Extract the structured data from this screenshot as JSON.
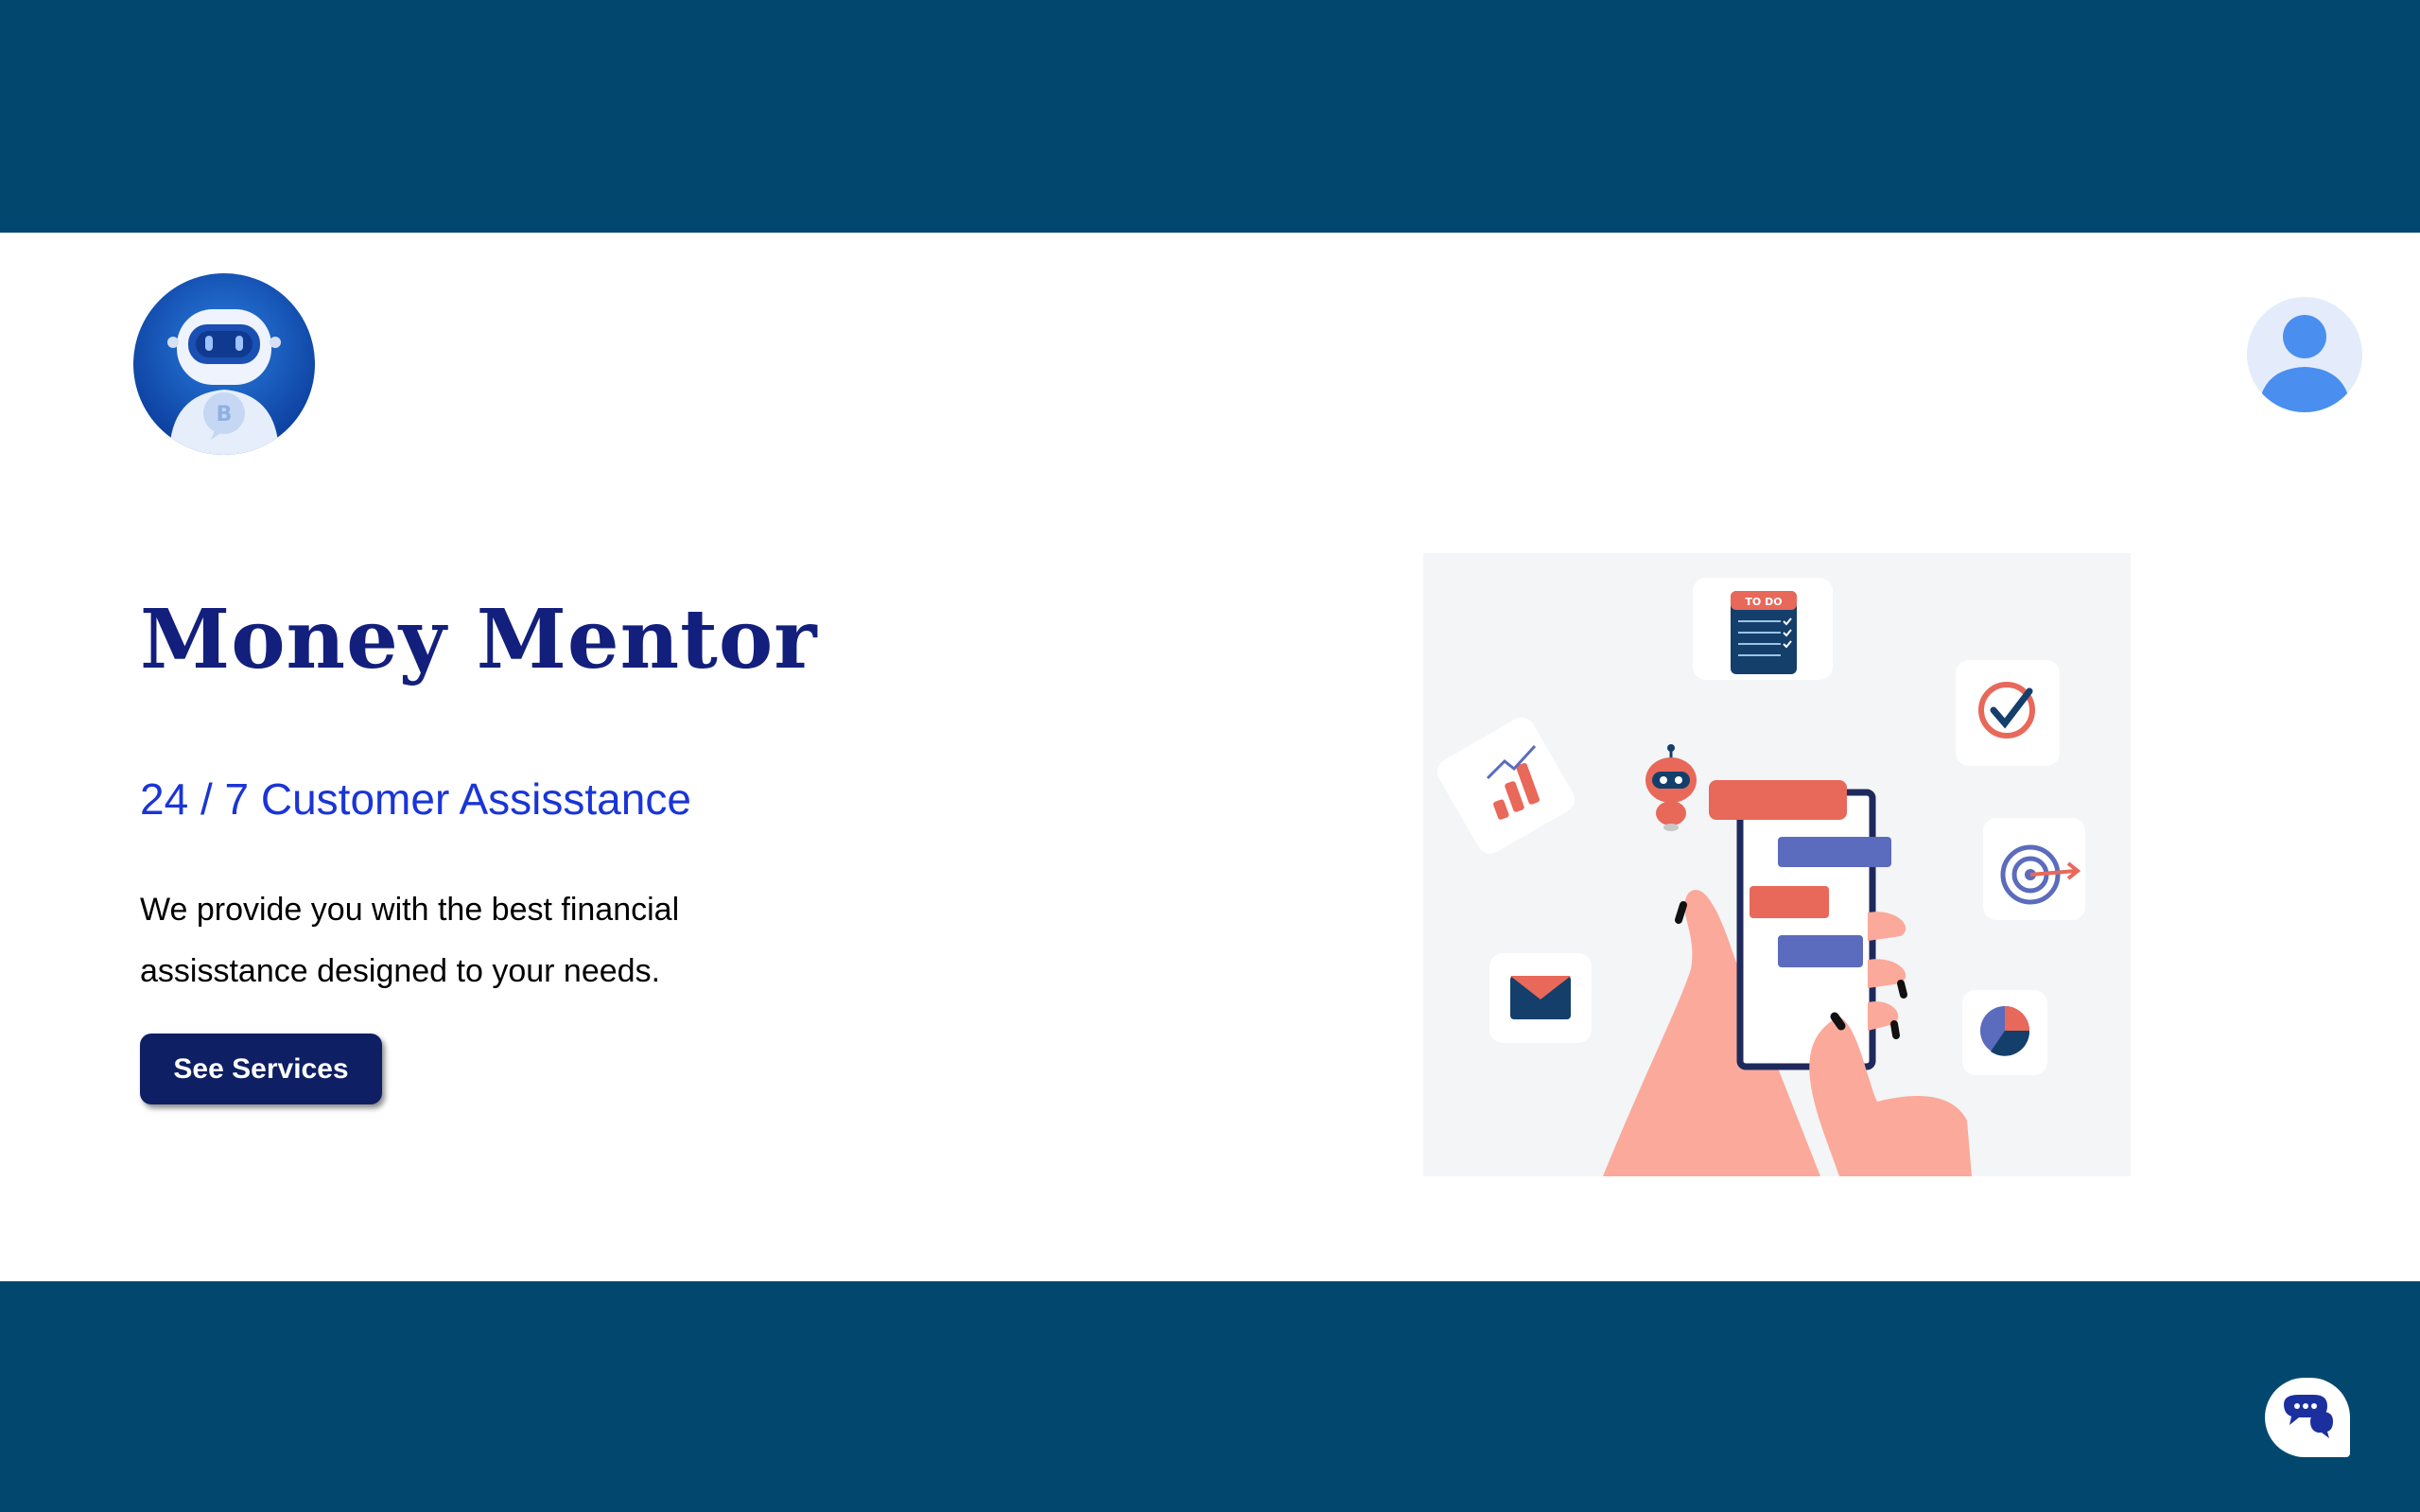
{
  "app": {
    "title": "Money Mentor",
    "subtitle": "24 / 7 Customer Assisstance",
    "description": "We provide you with the best financial assisstance designed to your needs.",
    "cta_label": "See Services"
  },
  "icons": {
    "logo": "robot-bitcoin-logo",
    "profile": "user-profile-icon",
    "chat": "chat-bubbles-icon"
  },
  "illustration": {
    "todo_label": "TO DO"
  },
  "colors": {
    "band": "#02486e",
    "title": "#121f7c",
    "subtitle": "#1a35d6",
    "button": "#0f1f63",
    "accent_red": "#e8685a",
    "accent_blue": "#5b6bbd",
    "skin": "#fba99a"
  }
}
